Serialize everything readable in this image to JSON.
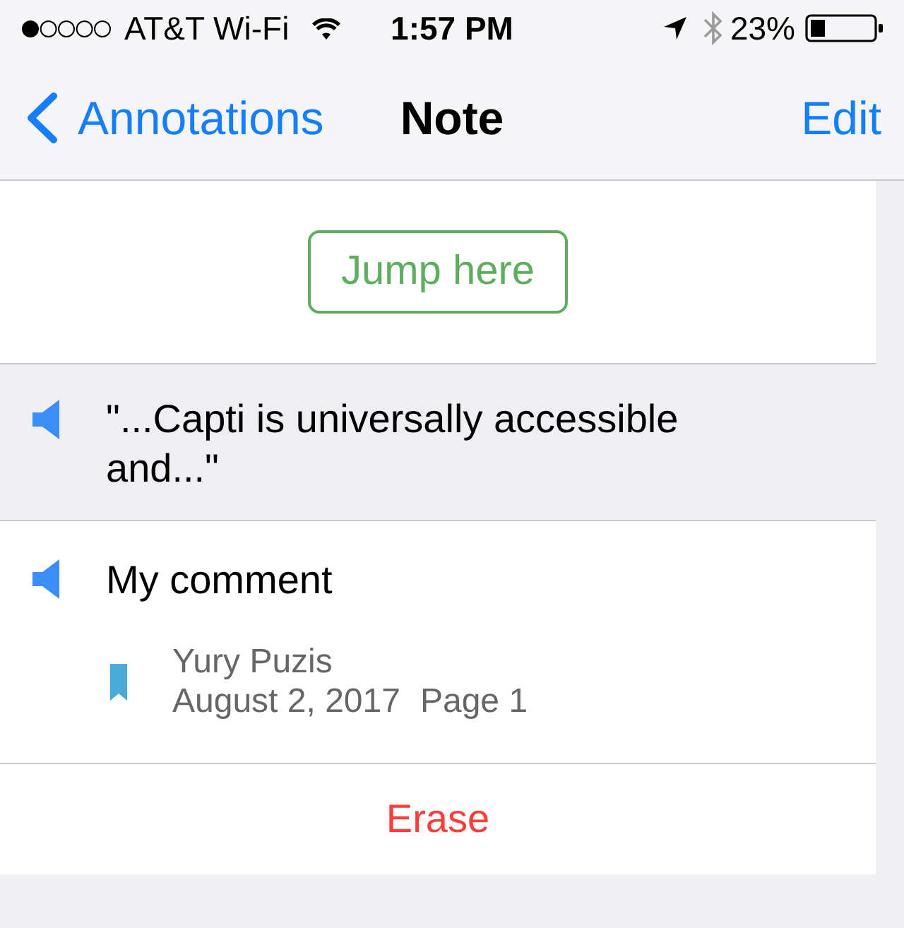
{
  "status_bar": {
    "carrier": "AT&T Wi-Fi",
    "time": "1:57 PM",
    "battery": "23%"
  },
  "nav_bar": {
    "back_label": "Annotations",
    "title": "Note",
    "action": "Edit"
  },
  "jump_button": {
    "label": "Jump here"
  },
  "items": [
    {
      "kind": "quote",
      "text": "\"...Capti is universally accessible and...\""
    },
    {
      "kind": "comment",
      "text": "My comment",
      "author": "Yury Puzis",
      "date": "August 2, 2017",
      "page": "Page 1"
    }
  ],
  "erase_button": {
    "label": "Erase"
  }
}
